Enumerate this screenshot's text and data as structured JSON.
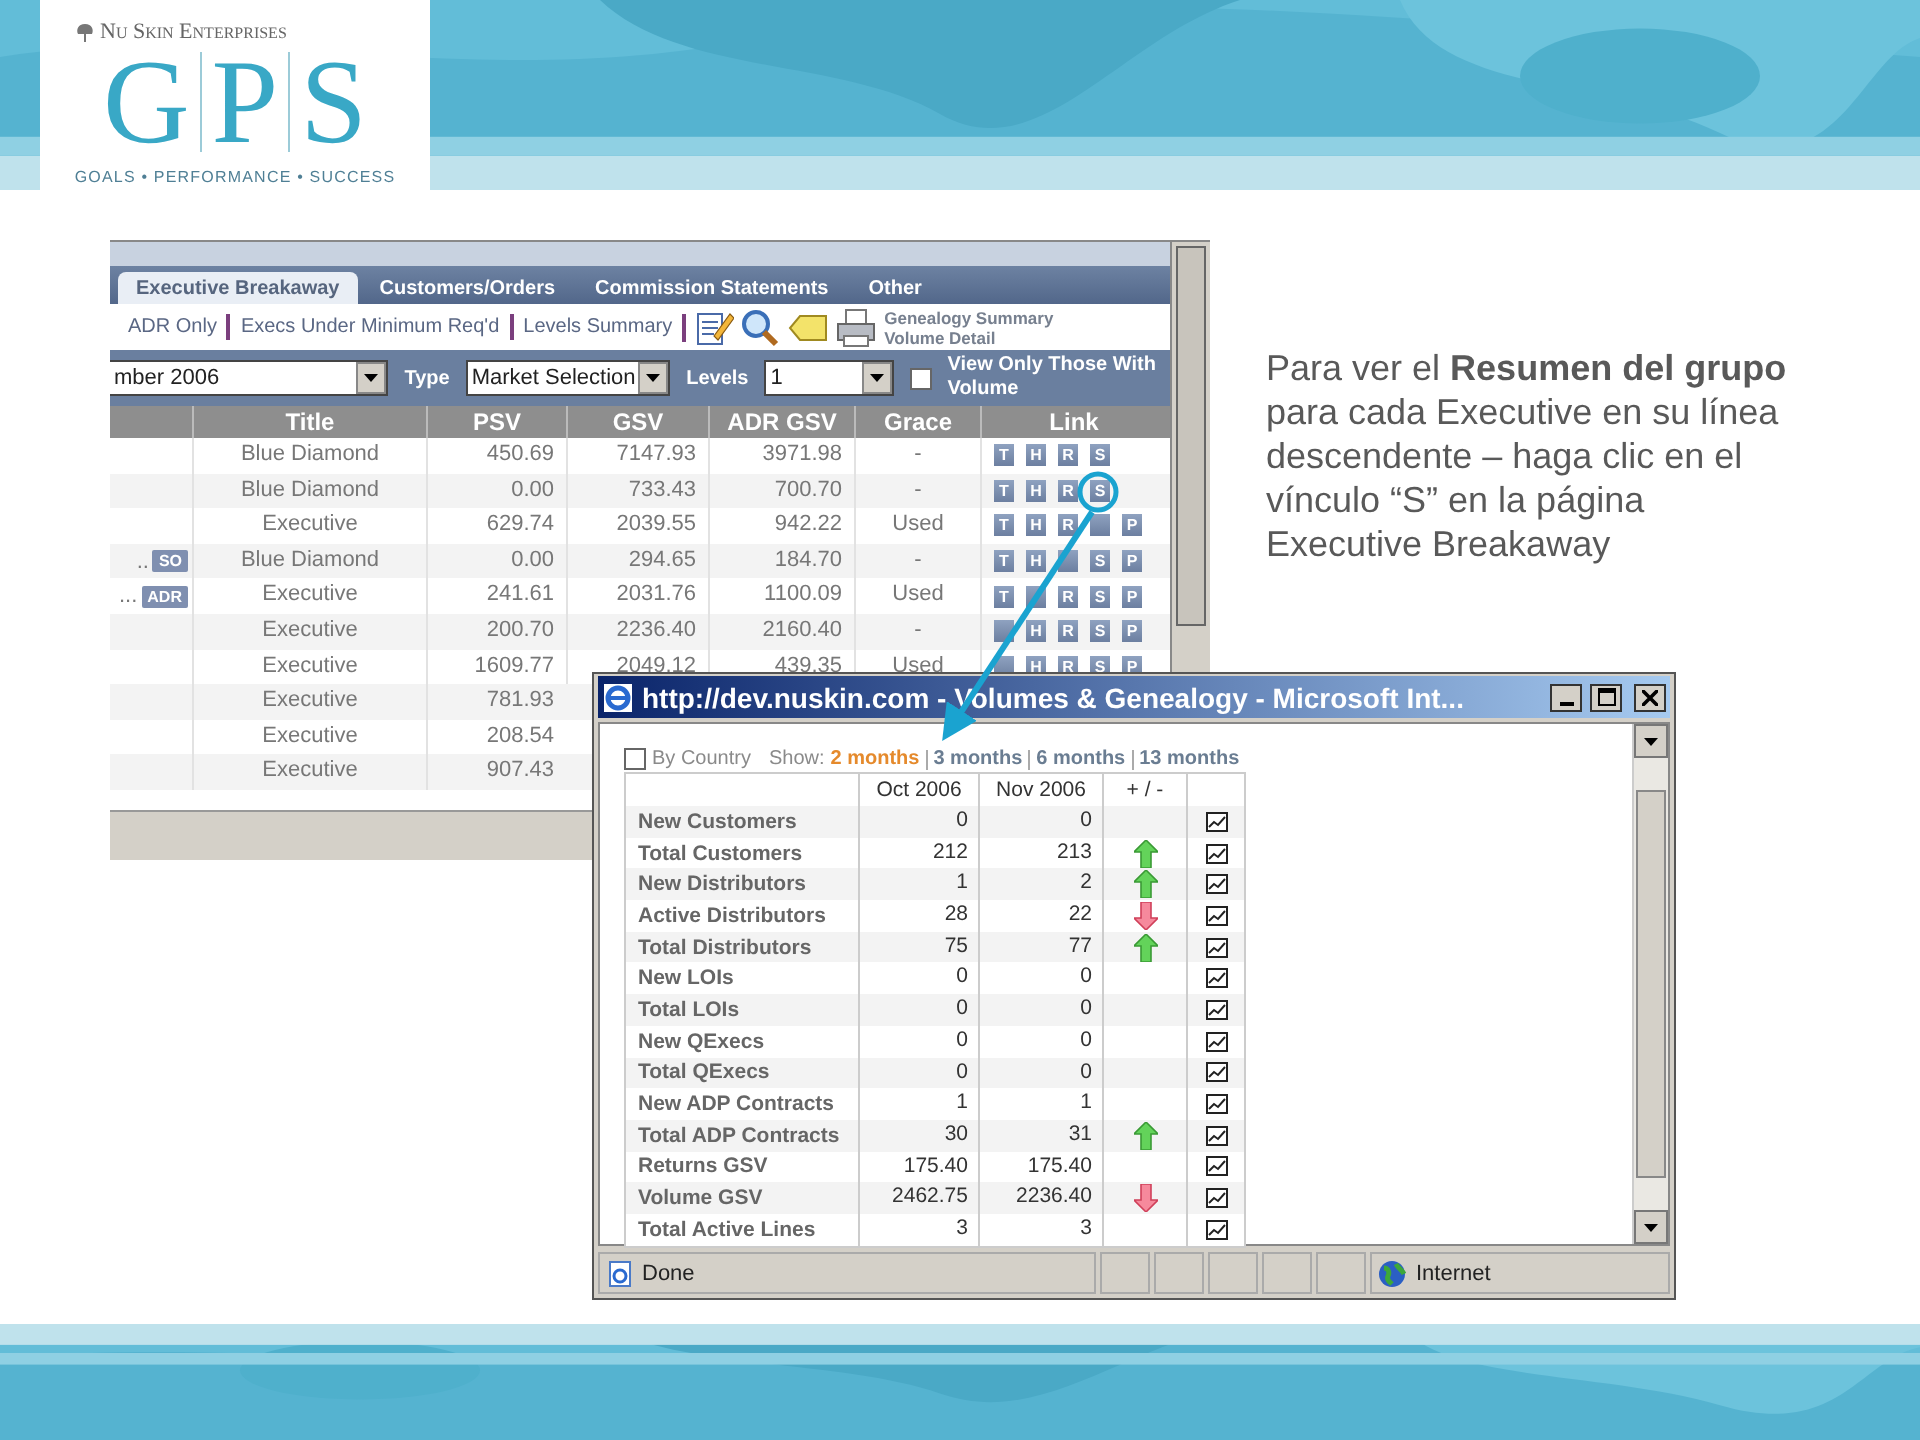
{
  "header": {
    "brand": "Nu Skin Enterprises",
    "logo_letters": [
      "G",
      "P",
      "S"
    ],
    "tagline": "GOALS • PERFORMANCE • SUCCESS"
  },
  "breakaway": {
    "tabs": [
      {
        "label": "Executive Breakaway",
        "selected": true
      },
      {
        "label": "Customers/Orders",
        "selected": false
      },
      {
        "label": "Commission Statements",
        "selected": false
      },
      {
        "label": "Other",
        "selected": false
      }
    ],
    "links": [
      "ADR Only",
      "Execs Under Minimum Req'd",
      "Levels Summary"
    ],
    "report_links": [
      "Genealogy Summary",
      "Volume Detail"
    ],
    "filters": {
      "month": "mber 2006",
      "type_label": "Type",
      "type": "Market Selection",
      "levels_label": "Levels",
      "levels": "1",
      "volume_only": {
        "label": "View Only Those With Volume",
        "checked": false
      }
    },
    "columns": [
      "Title",
      "PSV",
      "GSV",
      "ADR GSV",
      "Grace",
      "Link"
    ],
    "rows": [
      {
        "title": "Blue Diamond",
        "psv": "450.69",
        "gsv": "7147.93",
        "adr_gsv": "3971.98",
        "grace": "-",
        "links": [
          {
            "kind": "letter",
            "label": "T"
          },
          {
            "kind": "letter",
            "label": "H"
          },
          {
            "kind": "letter",
            "label": "R"
          },
          {
            "kind": "letter",
            "label": "S"
          }
        ]
      },
      {
        "title": "Blue Diamond",
        "psv": "0.00",
        "gsv": "733.43",
        "adr_gsv": "700.70",
        "grace": "-",
        "links": [
          {
            "kind": "letter",
            "label": "T"
          },
          {
            "kind": "letter",
            "label": "H"
          },
          {
            "kind": "letter",
            "label": "R"
          },
          {
            "kind": "letter",
            "label": "S"
          }
        ]
      },
      {
        "title": "Executive",
        "psv": "629.74",
        "gsv": "2039.55",
        "adr_gsv": "942.22",
        "grace": "Used",
        "links": [
          {
            "kind": "letter",
            "label": "T"
          },
          {
            "kind": "letter",
            "label": "H"
          },
          {
            "kind": "letter",
            "label": "R"
          },
          {
            "kind": "covered"
          },
          {
            "kind": "letter",
            "label": "P"
          }
        ]
      },
      {
        "name": "..",
        "badge": "SO",
        "title": "Blue Diamond",
        "psv": "0.00",
        "gsv": "294.65",
        "adr_gsv": "184.70",
        "grace": "-",
        "links": [
          {
            "kind": "letter",
            "label": "T"
          },
          {
            "kind": "letter",
            "label": "H"
          },
          {
            "kind": "covered"
          },
          {
            "kind": "letter",
            "label": "S"
          },
          {
            "kind": "letter",
            "label": "P"
          }
        ]
      },
      {
        "name": "...",
        "badge": "ADR",
        "title": "Executive",
        "psv": "241.61",
        "gsv": "2031.76",
        "adr_gsv": "1100.09",
        "grace": "Used",
        "links": [
          {
            "kind": "letter",
            "label": "T"
          },
          {
            "kind": "covered"
          },
          {
            "kind": "letter",
            "label": "R"
          },
          {
            "kind": "letter",
            "label": "S"
          },
          {
            "kind": "letter",
            "label": "P"
          }
        ]
      },
      {
        "title": "Executive",
        "psv": "200.70",
        "gsv": "2236.40",
        "adr_gsv": "2160.40",
        "grace": "-",
        "links": [
          {
            "kind": "covered"
          },
          {
            "kind": "letter",
            "label": "H"
          },
          {
            "kind": "letter",
            "label": "R"
          },
          {
            "kind": "letter",
            "label": "S"
          },
          {
            "kind": "letter",
            "label": "P"
          }
        ]
      },
      {
        "title": "Executive",
        "psv": "1609.77",
        "gsv": "2049.12",
        "adr_gsv": "439.35",
        "grace": "Used",
        "links": [
          {
            "kind": "covered"
          },
          {
            "kind": "letter",
            "label": "H"
          },
          {
            "kind": "letter",
            "label": "R"
          },
          {
            "kind": "letter",
            "label": "S"
          },
          {
            "kind": "letter",
            "label": "P"
          }
        ]
      },
      {
        "title": "Executive",
        "psv": "781.93"
      },
      {
        "title": "Executive",
        "psv": "208.54"
      },
      {
        "title": "Executive",
        "psv": "907.43"
      }
    ]
  },
  "popup": {
    "title": "http://dev.nuskin.com - Volumes & Genealogy - Microsoft Int...",
    "by_country": {
      "label": "By Country",
      "checked": false
    },
    "show_label": "Show:",
    "periods": [
      {
        "label": "2 months",
        "selected": true
      },
      {
        "label": "3 months",
        "selected": false
      },
      {
        "label": "6 months",
        "selected": false
      },
      {
        "label": "13 months",
        "selected": false
      }
    ],
    "columns": [
      "Oct 2006",
      "Nov 2006",
      "+ / -"
    ],
    "rows": [
      {
        "label": "New Customers",
        "oct": "0",
        "nov": "0",
        "kind": "flat"
      },
      {
        "label": "Total Customers",
        "oct": "212",
        "nov": "213",
        "kind": "rise"
      },
      {
        "label": "New Distributors",
        "oct": "1",
        "nov": "2",
        "kind": "rise"
      },
      {
        "label": "Active Distributors",
        "oct": "28",
        "nov": "22",
        "kind": "fall"
      },
      {
        "label": "Total Distributors",
        "oct": "75",
        "nov": "77",
        "kind": "rise"
      },
      {
        "label": "New LOIs",
        "oct": "0",
        "nov": "0",
        "kind": "flat"
      },
      {
        "label": "Total LOIs",
        "oct": "0",
        "nov": "0",
        "kind": "flat"
      },
      {
        "label": "New QExecs",
        "oct": "0",
        "nov": "0",
        "kind": "flat"
      },
      {
        "label": "Total QExecs",
        "oct": "0",
        "nov": "0",
        "kind": "flat"
      },
      {
        "label": "New ADP Contracts",
        "oct": "1",
        "nov": "1",
        "kind": "flat"
      },
      {
        "label": "Total ADP Contracts",
        "oct": "30",
        "nov": "31",
        "kind": "rise"
      },
      {
        "label": "Returns GSV",
        "oct": "175.40",
        "nov": "175.40",
        "kind": "flat"
      },
      {
        "label": "Volume GSV",
        "oct": "2462.75",
        "nov": "2236.40",
        "kind": "fall"
      },
      {
        "label": "Total Active Lines",
        "oct": "3",
        "nov": "3",
        "kind": "flat"
      }
    ],
    "status": "Done",
    "zone": "Internet"
  },
  "note": "Para ver el **Resumen del grupo** para cada Executive en su línea descendente – haga clic en el vínculo “S” en la página Executive Breakaway"
}
